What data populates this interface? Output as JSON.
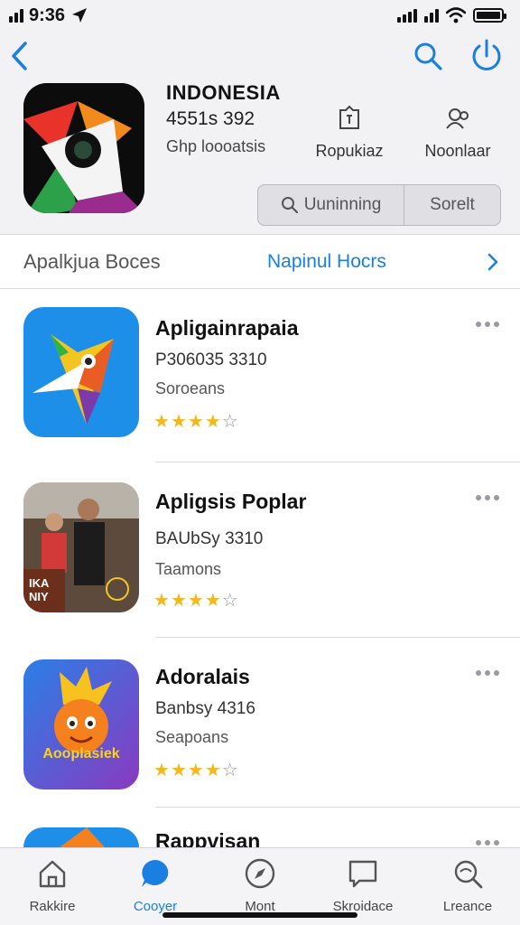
{
  "status_bar": {
    "time": "9:36"
  },
  "header": {
    "app_title": "INDONESIA",
    "app_count": "4551s 392",
    "app_subtitle": "Ghp loooatsis",
    "meta": [
      {
        "label": "Ropukiaz",
        "icon": "badge-icon"
      },
      {
        "label": "Noonlaar",
        "icon": "reviews-icon"
      }
    ],
    "segment": {
      "left_label": "Uuninning",
      "right_label": "Sorelt"
    }
  },
  "section": {
    "title": "Apalkjua Boces",
    "link": "Napinul Hocrs"
  },
  "apps": [
    {
      "name": "Apligainrapaia",
      "code": "P306035 3310",
      "category": "Soroeans",
      "rating": 4,
      "max_rating": 5
    },
    {
      "name": "Apligsis Poplar",
      "code": "BAUbSy 3310",
      "category": "Taamons",
      "rating": 4,
      "max_rating": 5,
      "icon_text": "IKA NIY"
    },
    {
      "name": "Adoralais",
      "code": "Banbsy 4316",
      "category": "Seapoans",
      "rating": 4,
      "max_rating": 5,
      "icon_text": "Aooplasiek"
    },
    {
      "name": "Rappvisan"
    }
  ],
  "tabbar": {
    "tabs": [
      {
        "label": "Rakkire",
        "icon": "home-icon",
        "active": false
      },
      {
        "label": "Cooyer",
        "icon": "chat-icon",
        "active": true
      },
      {
        "label": "Mont",
        "icon": "compass-icon",
        "active": false
      },
      {
        "label": "Skroidace",
        "icon": "message-icon",
        "active": false
      },
      {
        "label": "Lreance",
        "icon": "search-icon",
        "active": false
      }
    ]
  },
  "colors": {
    "accent": "#1a7fe0",
    "star": "#f2b81c",
    "header_bg": "#f2f2f4"
  }
}
